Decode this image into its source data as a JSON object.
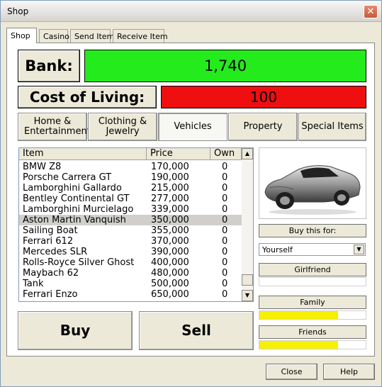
{
  "window": {
    "title": "Shop",
    "close_glyph": "✕"
  },
  "tabs": [
    {
      "label": "Shop",
      "active": true
    },
    {
      "label": "Casino"
    },
    {
      "label": "Send Item"
    },
    {
      "label": "Receive Item"
    }
  ],
  "bank": {
    "label": "Bank:",
    "value": "1,740"
  },
  "cost_of_living": {
    "label": "Cost of Living:",
    "value": "100"
  },
  "categories": [
    {
      "label": "Home & Entertainment"
    },
    {
      "label": "Clothing & Jewelry"
    },
    {
      "label": "Vehicles",
      "selected": true
    },
    {
      "label": "Property"
    },
    {
      "label": "Special Items"
    }
  ],
  "list": {
    "columns": [
      "Item",
      "Price",
      "Own"
    ],
    "rows": [
      {
        "item": "BMW Z8",
        "price": "170,000",
        "own": "0"
      },
      {
        "item": "Porsche Carrera GT",
        "price": "190,000",
        "own": "0"
      },
      {
        "item": "Lamborghini Gallardo",
        "price": "215,000",
        "own": "0"
      },
      {
        "item": "Bentley Continental GT",
        "price": "277,000",
        "own": "0"
      },
      {
        "item": "Lamborghini Murcielago",
        "price": "339,000",
        "own": "0"
      },
      {
        "item": "Aston Martin Vanquish",
        "price": "350,000",
        "own": "0",
        "selected": true
      },
      {
        "item": "Sailing Boat",
        "price": "355,000",
        "own": "0"
      },
      {
        "item": "Ferrari 612",
        "price": "370,000",
        "own": "0"
      },
      {
        "item": "Mercedes SLR",
        "price": "390,000",
        "own": "0"
      },
      {
        "item": "Rolls-Royce Silver Ghost",
        "price": "400,000",
        "own": "0"
      },
      {
        "item": "Maybach 62",
        "price": "480,000",
        "own": "0"
      },
      {
        "item": "Tank",
        "price": "500,000",
        "own": "0"
      },
      {
        "item": "Ferrari Enzo",
        "price": "650,000",
        "own": "0"
      }
    ]
  },
  "actions": {
    "buy": "Buy",
    "sell": "Sell"
  },
  "side": {
    "buy_for_label": "Buy this for:",
    "buy_for_value": "Yourself",
    "girlfriend_label": "Girlfriend",
    "girlfriend_level": 0,
    "family_label": "Family",
    "family_level": 0.74,
    "friends_label": "Friends",
    "friends_level": 0.74,
    "bar_color": "#f7f000"
  },
  "footer": {
    "close": "Close",
    "help": "Help"
  }
}
